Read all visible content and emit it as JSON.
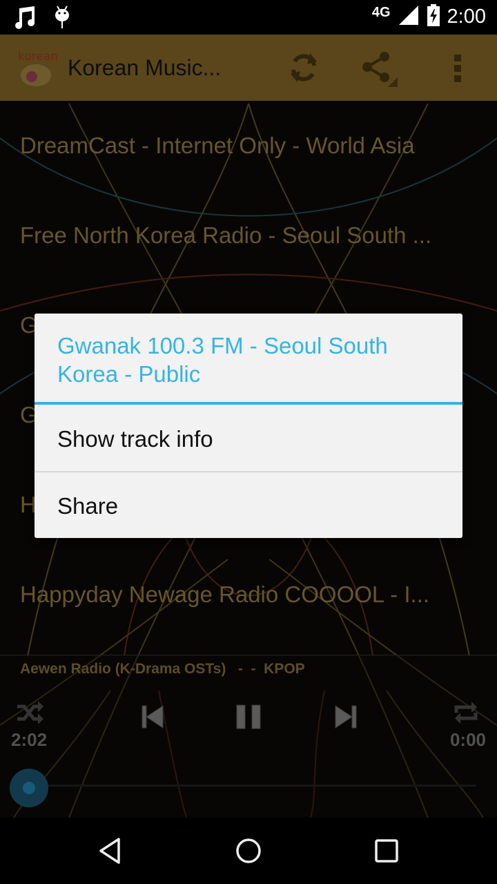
{
  "status_bar": {
    "icons_left": [
      "music-note-icon",
      "android-debug-icon"
    ],
    "network": "4G",
    "signal_icon": "signal-icon",
    "battery_icon": "battery-charging-icon",
    "time": "2:00"
  },
  "action_bar": {
    "title": "Korean Music...",
    "app_icon_text": "korean",
    "actions": [
      {
        "name": "refresh",
        "icon": "refresh-icon"
      },
      {
        "name": "share",
        "icon": "share-icon"
      },
      {
        "name": "overflow",
        "icon": "more-vert-icon"
      }
    ],
    "color": "#6b5320"
  },
  "stations": [
    {
      "label": "DreamCast  - Internet Only  - World Asia"
    },
    {
      "label": "Free North Korea Radio - Seoul South ..."
    },
    {
      "label": "G"
    },
    {
      "label": "G"
    },
    {
      "label": "H"
    },
    {
      "label": "Happyday Newage Radio COOOOL - I..."
    }
  ],
  "player": {
    "now_playing": "Aewen Radio (K-Drama OSTs)   -  -  KPOP",
    "elapsed": "2:02",
    "duration": "0:00",
    "controls": [
      "shuffle-icon",
      "previous-icon",
      "pause-icon",
      "next-icon",
      "repeat-icon"
    ],
    "progress_fraction": 0.0
  },
  "dialog": {
    "title": "Gwanak 100.3 FM - Seoul South Korea - Public",
    "items": [
      {
        "label": "Show track info"
      },
      {
        "label": "Share"
      }
    ],
    "accent": "#33b5e5"
  },
  "nav_bar": {
    "buttons": [
      "back",
      "home",
      "recents"
    ]
  }
}
